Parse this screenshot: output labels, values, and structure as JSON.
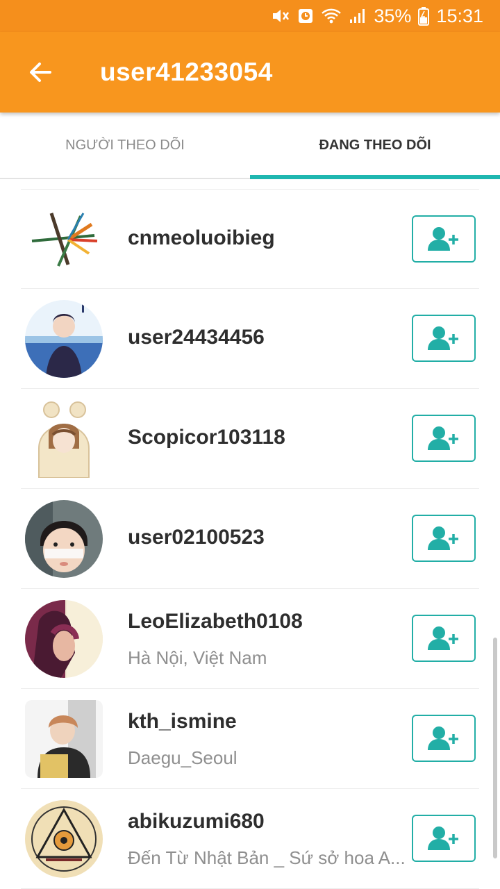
{
  "status_bar": {
    "battery": "35%",
    "time": "15:31",
    "icons": [
      "mute-icon",
      "alarm-icon",
      "wifi-icon",
      "signal-icon",
      "battery-icon"
    ]
  },
  "app_bar": {
    "title": "user41233054",
    "back_icon": "back-arrow-icon"
  },
  "tabs": [
    {
      "label": "NGƯỜI THEO DÕI",
      "active": false
    },
    {
      "label": "ĐANG THEO DÕI",
      "active": true
    }
  ],
  "colors": {
    "primary": "#f8961e",
    "accent": "#1fb7b0"
  },
  "users": [
    {
      "name": "cnmeoluoibieg",
      "subtitle": ""
    },
    {
      "name": "user24434456",
      "subtitle": ""
    },
    {
      "name": "Scopicor103118",
      "subtitle": ""
    },
    {
      "name": "user02100523",
      "subtitle": ""
    },
    {
      "name": "LeoElizabeth0108",
      "subtitle": "Hà Nội, Việt Nam"
    },
    {
      "name": "kth_ismine",
      "subtitle": "Daegu_Seoul"
    },
    {
      "name": "abikuzumi680",
      "subtitle": "Đến Từ Nhật Bản _ Sứ sở hoa A..."
    }
  ],
  "follow_button_icon": "add-user-icon"
}
